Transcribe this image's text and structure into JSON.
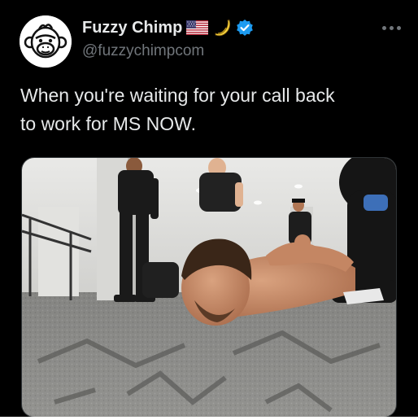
{
  "tweet": {
    "author_name": "Fuzzy Chimp",
    "handle": "@fuzzychimpcom",
    "text_lines": [
      "When you're waiting for your call back",
      "to work for MS NOW."
    ],
    "name_icons": [
      "us-flag-icon",
      "banana-icon",
      "verified-badge-icon"
    ],
    "more_icon": "more-options-icon"
  },
  "colors": {
    "background": "#000000",
    "primary_text": "#e7e9ea",
    "secondary_text": "#71767b",
    "verified_blue": "#1d9bf0"
  },
  "media": {
    "kind": "photo"
  }
}
